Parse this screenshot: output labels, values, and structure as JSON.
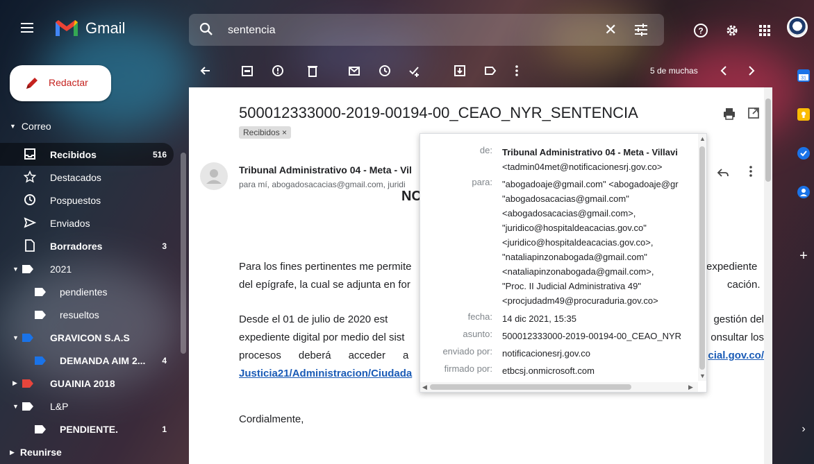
{
  "app": {
    "name": "Gmail"
  },
  "search": {
    "value": "sentencia"
  },
  "compose": {
    "label": "Redactar"
  },
  "sidebar": {
    "section_mail": "Correo",
    "items": [
      {
        "label": "Recibidos",
        "count": "516"
      },
      {
        "label": "Destacados",
        "count": ""
      },
      {
        "label": "Pospuestos",
        "count": ""
      },
      {
        "label": "Enviados",
        "count": ""
      },
      {
        "label": "Borradores",
        "count": "3"
      }
    ],
    "labels": [
      {
        "label": "2021",
        "count": ""
      },
      {
        "label": "pendientes",
        "count": ""
      },
      {
        "label": "resueltos",
        "count": ""
      },
      {
        "label": "GRAVICON S.A.S",
        "count": ""
      },
      {
        "label": "DEMANDA AIM 2...",
        "count": "4"
      },
      {
        "label": "GUAINIA 2018",
        "count": ""
      },
      {
        "label": "L&P",
        "count": ""
      },
      {
        "label": "PENDIENTE.",
        "count": "1"
      }
    ],
    "section_meet": "Reunirse"
  },
  "toolbar": {
    "count_label": "5 de muchas"
  },
  "message": {
    "subject": "500012333000-2019-00194-00_CEAO_NYR_SENTENCIA",
    "chip": "Recibidos ×",
    "sender": "Tribunal Administrativo 04 - Meta - Vil",
    "recipients": "para mí, abogadosacacias@gmail.com, juridi",
    "heading_fragment": "NC",
    "p1_a": "Para los fines pertinentes me permite",
    "p1_b": "del epígrafe, la cual se adjunta en for",
    "p1_c": "expediente",
    "p1_d": "cación.",
    "p2_l1": "Desde el 01 de julio de 2020 est",
    "p2_l2": "expediente digital por medio del sist",
    "p2_l3a": "procesos      deberá      acceder      a",
    "p2_link": "Justicia21/Administracion/Ciudada",
    "p2_r1": "gestión del",
    "p2_r2": "onsultar los",
    "p2_r3": "cial.gov.co/",
    "signoff": "Cordialmente,"
  },
  "details": {
    "rows": [
      {
        "key": "de:",
        "lines": [
          "Tribunal Administrativo 04 - Meta - Villavi",
          "<tadmin04met@notificacionesrj.gov.co>"
        ]
      },
      {
        "key": "para:",
        "lines": [
          "\"abogadoaje@gmail.com\" <abogadoaje@gr",
          "\"abogadosacacias@gmail.com\"",
          "<abogadosacacias@gmail.com>,",
          "\"juridico@hospitaldeacacias.gov.co\"",
          "<juridico@hospitaldeacacias.gov.co>,",
          "\"nataliapinzonabogada@gmail.com\"",
          "<nataliapinzonabogada@gmail.com>,",
          "\"Proc. II Judicial Administrativa 49\"",
          "<procjudadm49@procuraduria.gov.co>"
        ]
      },
      {
        "key": "fecha:",
        "lines": [
          "14 dic 2021, 15:35"
        ]
      },
      {
        "key": "asunto:",
        "lines": [
          "500012333000-2019-00194-00_CEAO_NYR"
        ]
      },
      {
        "key": "enviado por:",
        "lines": [
          "notificacionesrj.gov.co"
        ]
      },
      {
        "key": "firmado por:",
        "lines": [
          "etbcsj.onmicrosoft.com"
        ]
      }
    ]
  },
  "colors": {
    "accent_red": "#c5221f",
    "link_blue": "#1a5bb6"
  }
}
